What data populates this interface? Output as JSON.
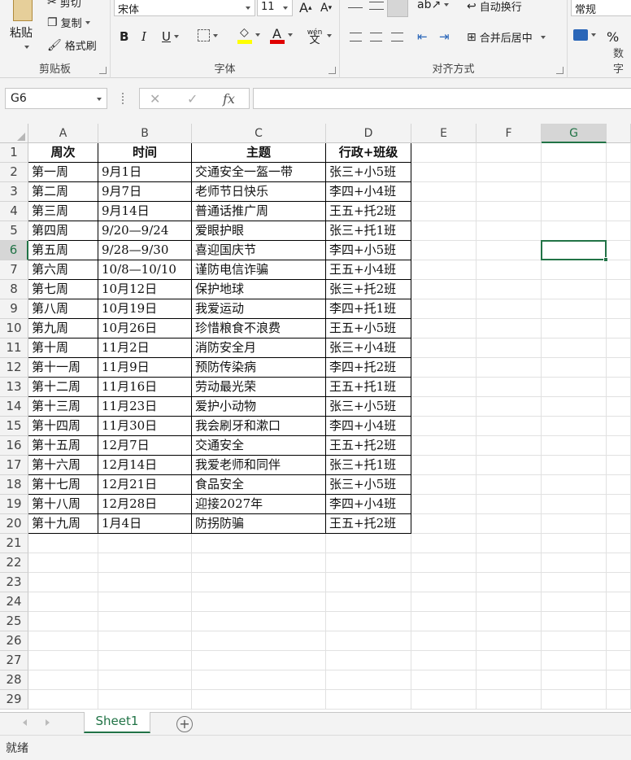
{
  "ribbon": {
    "clipboard": {
      "paste_label": "粘贴",
      "cut_label": "剪切",
      "copy_label": "复制",
      "format_painter_label": "格式刷",
      "group_label": "剪贴板"
    },
    "font": {
      "font_name": "宋体",
      "font_size": "11",
      "grow_label": "A",
      "shrink_label": "A",
      "bold_label": "B",
      "italic_label": "I",
      "underline_label": "U",
      "font_color_label": "A",
      "phonetic_label": "wén",
      "group_label": "字体"
    },
    "alignment": {
      "wrap_text_label": "自动换行",
      "merge_center_label": "合并后居中",
      "group_label": "对齐方式"
    },
    "number": {
      "format": "常规",
      "percent_label": "%",
      "group_label": "数字"
    }
  },
  "formula_bar": {
    "name_box": "G6",
    "cancel_symbol": "✕",
    "enter_symbol": "✓",
    "fx_label": "fx",
    "formula": ""
  },
  "columns": [
    "A",
    "B",
    "C",
    "D",
    "E",
    "F",
    "G"
  ],
  "active_column": "G",
  "active_row": "6",
  "row_numbers": [
    "1",
    "2",
    "3",
    "4",
    "5",
    "6",
    "7",
    "8",
    "9",
    "10",
    "11",
    "12",
    "13",
    "14",
    "15",
    "16",
    "17",
    "18",
    "19",
    "20",
    "21",
    "22",
    "23",
    "24",
    "25",
    "26",
    "27",
    "28",
    "29"
  ],
  "table": {
    "headers": [
      "周次",
      "时间",
      "主题",
      "行政+班级"
    ],
    "rows": [
      [
        "第一周",
        "9月1日",
        "交通安全一盔一带",
        "张三+小5班"
      ],
      [
        "第二周",
        "9月7日",
        "老师节日快乐",
        "李四+小4班"
      ],
      [
        "第三周",
        "9月14日",
        "普通话推广周",
        "王五+托2班"
      ],
      [
        "第四周",
        "9/20—9/24",
        "爱眼护眼",
        "张三+托1班"
      ],
      [
        "第五周",
        "9/28—9/30",
        "喜迎国庆节",
        "李四+小5班"
      ],
      [
        "第六周",
        "10/8—10/10",
        "谨防电信诈骗",
        "王五+小4班"
      ],
      [
        "第七周",
        "10月12日",
        "保护地球",
        "张三+托2班"
      ],
      [
        "第八周",
        "10月19日",
        "我爱运动",
        "李四+托1班"
      ],
      [
        "第九周",
        "10月26日",
        "珍惜粮食不浪费",
        "王五+小5班"
      ],
      [
        "第十周",
        "11月2日",
        "消防安全月",
        "张三+小4班"
      ],
      [
        "第十一周",
        "11月9日",
        "预防传染病",
        "李四+托2班"
      ],
      [
        "第十二周",
        "11月16日",
        "劳动最光荣",
        "王五+托1班"
      ],
      [
        "第十三周",
        "11月23日",
        "爱护小动物",
        "张三+小5班"
      ],
      [
        "第十四周",
        "11月30日",
        "我会刷牙和漱口",
        "李四+小4班"
      ],
      [
        "第十五周",
        "12月7日",
        "交通安全",
        "王五+托2班"
      ],
      [
        "第十六周",
        "12月14日",
        "我爱老师和同伴",
        "张三+托1班"
      ],
      [
        "第十七周",
        "12月21日",
        "食品安全",
        "张三+小5班"
      ],
      [
        "第十八周",
        "12月28日",
        "迎接2027年",
        "李四+小4班"
      ],
      [
        "第十九周",
        "1月4日",
        "防拐防骗",
        "王五+托2班"
      ]
    ]
  },
  "sheet_tabs": [
    {
      "label": "Sheet1",
      "active": true
    }
  ],
  "add_sheet_symbol": "+",
  "status": {
    "text": "就绪"
  },
  "colors": {
    "accent": "#217346",
    "font_color_bar": "#e00000",
    "highlight_bar": "#ffff00"
  }
}
